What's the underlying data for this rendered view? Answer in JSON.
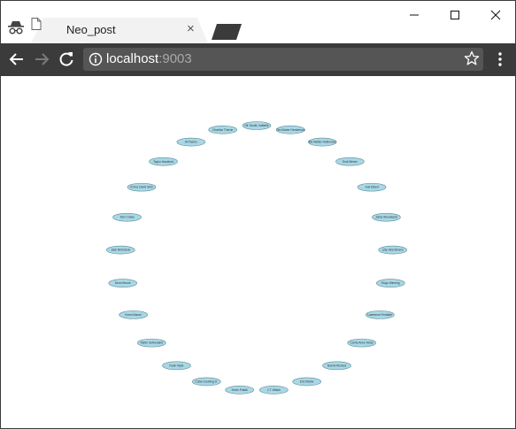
{
  "browser": {
    "tab_title": "Neo_post",
    "tab_close": "×",
    "url_host": "localhost",
    "url_port": ":9003",
    "icons": [
      "incognito-icon",
      "page-icon",
      "close-icon",
      "minimize-icon",
      "maximize-icon",
      "back-arrow-icon",
      "forward-arrow-icon",
      "reload-icon",
      "info-icon",
      "star-icon",
      "menu-dots-icon"
    ]
  },
  "graph": {
    "node_fill": "#a8d8e6",
    "node_stroke": "#5a8a98",
    "nodes": [
      "Hir Gould, Isabelle",
      "Tim Maher Henderson",
      "Ma Walter Holbrooke",
      "Emil Winter",
      "Joel Elbert",
      "Jama Woodward",
      "Lilly Hirschmann",
      "Hugo Winning",
      "Lawrence Findlater",
      "Carrie Anne Moss",
      "Noemi Richers",
      "Eric Maher",
      "J.T. Walsh",
      "Kevin Pollak",
      "Cuba Gooding Jr.",
      "Noah Wyle",
      "Kiefer Sutherland",
      "Kevin Bacon",
      "Demi Moore",
      "Jack Nicholson",
      "Tom Cruise",
      "R.Roz Darid Shin",
      "Taylor Hackford",
      "Al Pacino",
      "Charlize Theron"
    ]
  }
}
